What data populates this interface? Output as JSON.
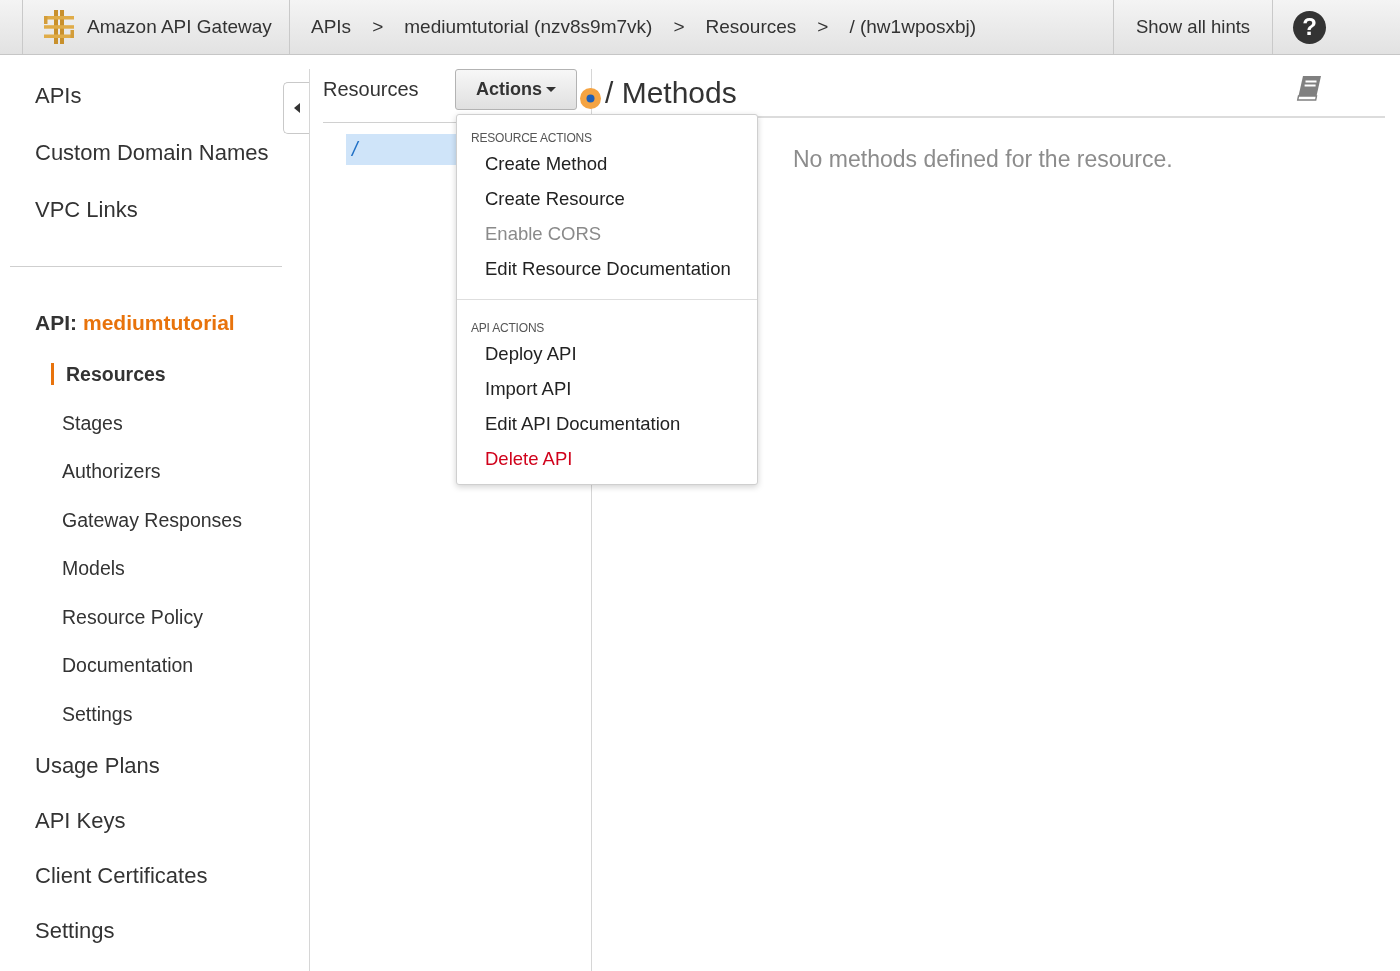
{
  "header": {
    "product": "Amazon API Gateway",
    "breadcrumbs": [
      {
        "label": "APIs",
        "separator": ">"
      },
      {
        "label": "mediumtutorial (nzv8s9m7vk)",
        "separator": ">"
      },
      {
        "label": "Resources",
        "separator": ">"
      },
      {
        "label": "/ (hw1wposxbj)"
      }
    ],
    "hints_button": "Show all hints",
    "help_button": "?"
  },
  "sidebar": {
    "top_items": [
      {
        "label": "APIs",
        "selected": false
      },
      {
        "label": "Custom Domain Names",
        "selected": false
      },
      {
        "label": "VPC Links",
        "selected": false
      }
    ],
    "api_label": "API:",
    "api_name": "mediumtutorial",
    "api_items": [
      {
        "label": "Resources",
        "selected": true
      },
      {
        "label": "Stages",
        "selected": false
      },
      {
        "label": "Authorizers",
        "selected": false
      },
      {
        "label": "Gateway Responses",
        "selected": false
      },
      {
        "label": "Models",
        "selected": false
      },
      {
        "label": "Resource Policy",
        "selected": false
      },
      {
        "label": "Documentation",
        "selected": false
      },
      {
        "label": "Settings",
        "selected": false
      }
    ],
    "bottom_items": [
      {
        "label": "Usage Plans",
        "selected": false
      },
      {
        "label": "API Keys",
        "selected": false
      },
      {
        "label": "Client Certificates",
        "selected": false
      },
      {
        "label": "Settings",
        "selected": false
      }
    ]
  },
  "resources_panel": {
    "title": "Resources",
    "actions_button": "Actions",
    "tree": [
      {
        "label": "/",
        "selected": true
      }
    ]
  },
  "actions_menu": {
    "sections": [
      {
        "heading": "RESOURCE ACTIONS",
        "items": [
          {
            "label": "Create Method",
            "kind": "action",
            "disabled": false
          },
          {
            "label": "Create Resource",
            "kind": "action",
            "disabled": false
          },
          {
            "label": "Enable CORS",
            "kind": "action",
            "disabled": true
          },
          {
            "label": "Edit Resource Documentation",
            "kind": "action",
            "disabled": false
          }
        ]
      },
      {
        "heading": "API ACTIONS",
        "items": [
          {
            "label": "Deploy API",
            "kind": "action",
            "disabled": false
          },
          {
            "label": "Import API",
            "kind": "action",
            "disabled": false
          },
          {
            "label": "Edit API Documentation",
            "kind": "action",
            "disabled": false
          },
          {
            "label": "Delete API",
            "kind": "danger",
            "disabled": false
          }
        ]
      }
    ]
  },
  "methods": {
    "title": "/ Methods",
    "empty_message": "No methods defined for the resource."
  }
}
